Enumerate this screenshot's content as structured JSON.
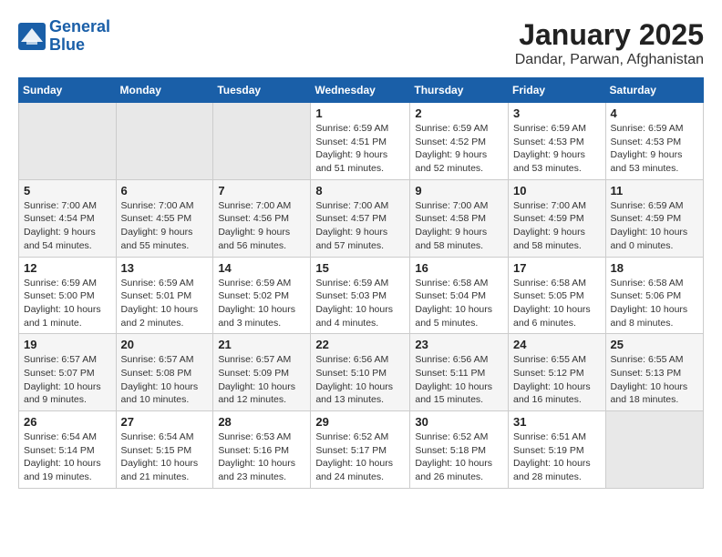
{
  "logo": {
    "line1": "General",
    "line2": "Blue"
  },
  "title": "January 2025",
  "subtitle": "Dandar, Parwan, Afghanistan",
  "days_of_week": [
    "Sunday",
    "Monday",
    "Tuesday",
    "Wednesday",
    "Thursday",
    "Friday",
    "Saturday"
  ],
  "weeks": [
    [
      {
        "day": "",
        "info": ""
      },
      {
        "day": "",
        "info": ""
      },
      {
        "day": "",
        "info": ""
      },
      {
        "day": "1",
        "info": "Sunrise: 6:59 AM\nSunset: 4:51 PM\nDaylight: 9 hours and 51 minutes."
      },
      {
        "day": "2",
        "info": "Sunrise: 6:59 AM\nSunset: 4:52 PM\nDaylight: 9 hours and 52 minutes."
      },
      {
        "day": "3",
        "info": "Sunrise: 6:59 AM\nSunset: 4:53 PM\nDaylight: 9 hours and 53 minutes."
      },
      {
        "day": "4",
        "info": "Sunrise: 6:59 AM\nSunset: 4:53 PM\nDaylight: 9 hours and 53 minutes."
      }
    ],
    [
      {
        "day": "5",
        "info": "Sunrise: 7:00 AM\nSunset: 4:54 PM\nDaylight: 9 hours and 54 minutes."
      },
      {
        "day": "6",
        "info": "Sunrise: 7:00 AM\nSunset: 4:55 PM\nDaylight: 9 hours and 55 minutes."
      },
      {
        "day": "7",
        "info": "Sunrise: 7:00 AM\nSunset: 4:56 PM\nDaylight: 9 hours and 56 minutes."
      },
      {
        "day": "8",
        "info": "Sunrise: 7:00 AM\nSunset: 4:57 PM\nDaylight: 9 hours and 57 minutes."
      },
      {
        "day": "9",
        "info": "Sunrise: 7:00 AM\nSunset: 4:58 PM\nDaylight: 9 hours and 58 minutes."
      },
      {
        "day": "10",
        "info": "Sunrise: 7:00 AM\nSunset: 4:59 PM\nDaylight: 9 hours and 58 minutes."
      },
      {
        "day": "11",
        "info": "Sunrise: 6:59 AM\nSunset: 4:59 PM\nDaylight: 10 hours and 0 minutes."
      }
    ],
    [
      {
        "day": "12",
        "info": "Sunrise: 6:59 AM\nSunset: 5:00 PM\nDaylight: 10 hours and 1 minute."
      },
      {
        "day": "13",
        "info": "Sunrise: 6:59 AM\nSunset: 5:01 PM\nDaylight: 10 hours and 2 minutes."
      },
      {
        "day": "14",
        "info": "Sunrise: 6:59 AM\nSunset: 5:02 PM\nDaylight: 10 hours and 3 minutes."
      },
      {
        "day": "15",
        "info": "Sunrise: 6:59 AM\nSunset: 5:03 PM\nDaylight: 10 hours and 4 minutes."
      },
      {
        "day": "16",
        "info": "Sunrise: 6:58 AM\nSunset: 5:04 PM\nDaylight: 10 hours and 5 minutes."
      },
      {
        "day": "17",
        "info": "Sunrise: 6:58 AM\nSunset: 5:05 PM\nDaylight: 10 hours and 6 minutes."
      },
      {
        "day": "18",
        "info": "Sunrise: 6:58 AM\nSunset: 5:06 PM\nDaylight: 10 hours and 8 minutes."
      }
    ],
    [
      {
        "day": "19",
        "info": "Sunrise: 6:57 AM\nSunset: 5:07 PM\nDaylight: 10 hours and 9 minutes."
      },
      {
        "day": "20",
        "info": "Sunrise: 6:57 AM\nSunset: 5:08 PM\nDaylight: 10 hours and 10 minutes."
      },
      {
        "day": "21",
        "info": "Sunrise: 6:57 AM\nSunset: 5:09 PM\nDaylight: 10 hours and 12 minutes."
      },
      {
        "day": "22",
        "info": "Sunrise: 6:56 AM\nSunset: 5:10 PM\nDaylight: 10 hours and 13 minutes."
      },
      {
        "day": "23",
        "info": "Sunrise: 6:56 AM\nSunset: 5:11 PM\nDaylight: 10 hours and 15 minutes."
      },
      {
        "day": "24",
        "info": "Sunrise: 6:55 AM\nSunset: 5:12 PM\nDaylight: 10 hours and 16 minutes."
      },
      {
        "day": "25",
        "info": "Sunrise: 6:55 AM\nSunset: 5:13 PM\nDaylight: 10 hours and 18 minutes."
      }
    ],
    [
      {
        "day": "26",
        "info": "Sunrise: 6:54 AM\nSunset: 5:14 PM\nDaylight: 10 hours and 19 minutes."
      },
      {
        "day": "27",
        "info": "Sunrise: 6:54 AM\nSunset: 5:15 PM\nDaylight: 10 hours and 21 minutes."
      },
      {
        "day": "28",
        "info": "Sunrise: 6:53 AM\nSunset: 5:16 PM\nDaylight: 10 hours and 23 minutes."
      },
      {
        "day": "29",
        "info": "Sunrise: 6:52 AM\nSunset: 5:17 PM\nDaylight: 10 hours and 24 minutes."
      },
      {
        "day": "30",
        "info": "Sunrise: 6:52 AM\nSunset: 5:18 PM\nDaylight: 10 hours and 26 minutes."
      },
      {
        "day": "31",
        "info": "Sunrise: 6:51 AM\nSunset: 5:19 PM\nDaylight: 10 hours and 28 minutes."
      },
      {
        "day": "",
        "info": ""
      }
    ]
  ]
}
